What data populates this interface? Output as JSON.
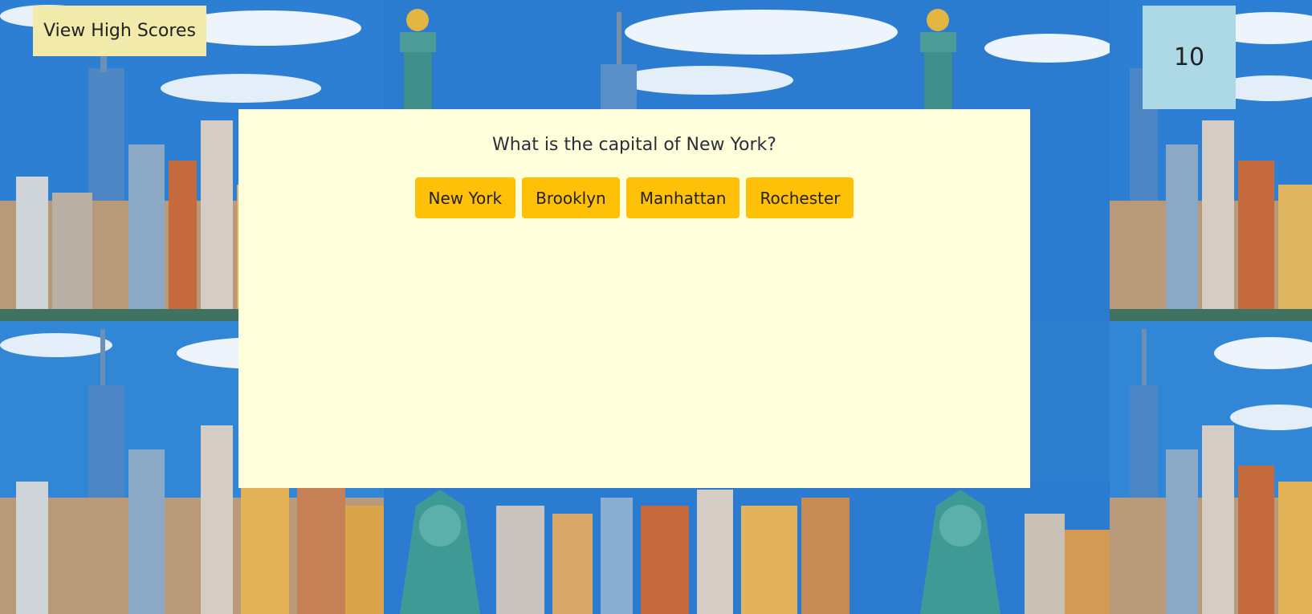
{
  "header": {
    "high_scores_label": "View High Scores"
  },
  "timer": {
    "value": "10"
  },
  "quiz": {
    "question": "What is the capital of New York?",
    "answers": [
      {
        "label": "New York"
      },
      {
        "label": "Brooklyn"
      },
      {
        "label": "Manhattan"
      },
      {
        "label": "Rochester"
      }
    ]
  },
  "colors": {
    "card_background": "#ffffdc",
    "answer_button": "#ffc107",
    "high_scores_button": "#f1eaaa",
    "timer_background": "#add8e6"
  },
  "background": {
    "image_semantic": "new-york-skyline-statue-of-liberty-tiled"
  }
}
